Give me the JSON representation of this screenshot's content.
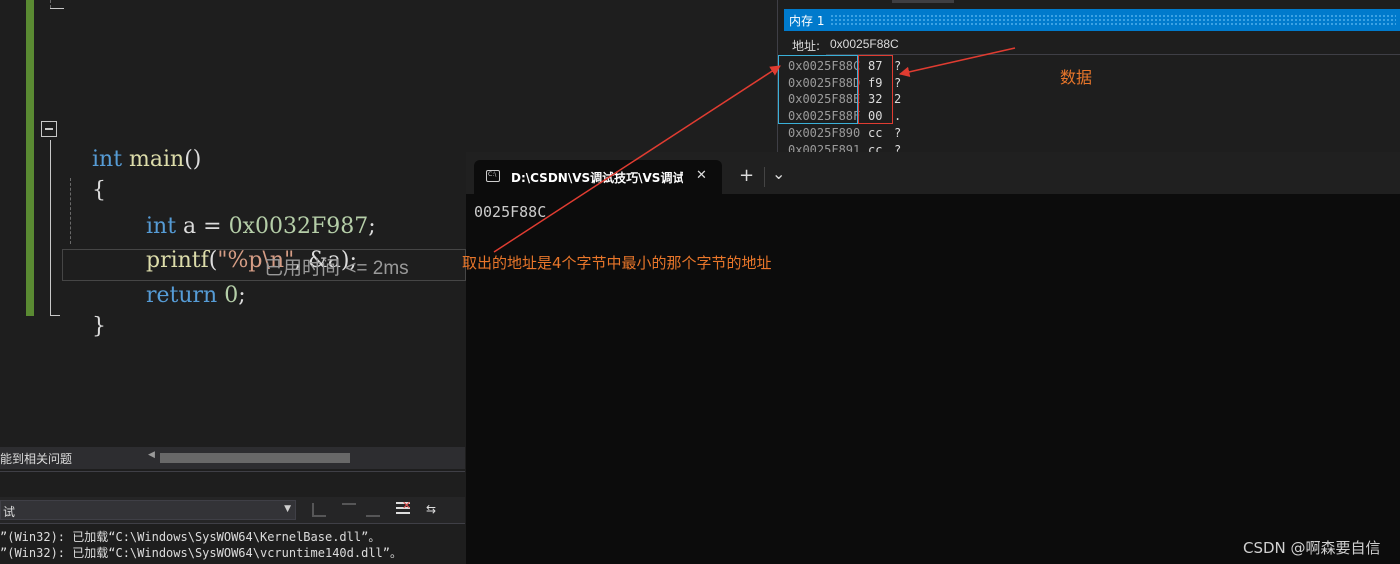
{
  "editor": {
    "line_main_kw": "int",
    "line_main_fn": "main",
    "line_main_paren": "()",
    "brace_open": "{",
    "brace_close": "}",
    "line_decl_kw": "int",
    "line_decl_rest": " a = ",
    "line_decl_val": "0x0032F987",
    "line_decl_semi": ";",
    "line_printf_fn": "printf",
    "line_printf_open": "(",
    "line_printf_str": "\"%p\\n\"",
    "line_printf_rest": ", &a);",
    "line_return_kw": "return",
    "line_return_val": " 0",
    "line_return_semi": ";",
    "elapsed_text": "已用时间 <= 2ms"
  },
  "output_panel": {
    "tab_text": "能到相关问题",
    "source_select": "试",
    "lines": [
      "”(Win32): 已加载“C:\\Windows\\SysWOW64\\KernelBase.dll”。",
      "”(Win32): 已加载“C:\\Windows\\SysWOW64\\vcruntime140d.dll”。"
    ]
  },
  "memory": {
    "title": "内存 1",
    "address_label": "地址:",
    "address_value": "0x0025F88C",
    "rows": [
      {
        "addr": "0x0025F88C",
        "hex": "87",
        "chr": "?"
      },
      {
        "addr": "0x0025F88D",
        "hex": "f9",
        "chr": "?"
      },
      {
        "addr": "0x0025F88E",
        "hex": "32",
        "chr": "2"
      },
      {
        "addr": "0x0025F88F",
        "hex": "00",
        "chr": "."
      },
      {
        "addr": "0x0025F890",
        "hex": "cc",
        "chr": "?"
      },
      {
        "addr": "0x0025F891",
        "hex": "cc",
        "chr": "?"
      }
    ]
  },
  "terminal": {
    "tab_title": "D:\\CSDN\\VS调试技巧\\VS调试",
    "icon_text": "C:\\",
    "close_glyph": "✕",
    "new_tab_glyph": "+",
    "dropdown_glyph": "⌄",
    "output": "0025F88C"
  },
  "annotations": {
    "data_label": "数据",
    "address_note": "取出的地址是4个字节中最小的那个字节的地址"
  },
  "watermark": "CSDN @啊森要自信",
  "colors": {
    "annotation": "#e8762a",
    "arrow": "#e03c31",
    "memory_title_bar": "#007acc",
    "addr_box": "#3ab0d8",
    "hex_box": "#e03c31"
  }
}
